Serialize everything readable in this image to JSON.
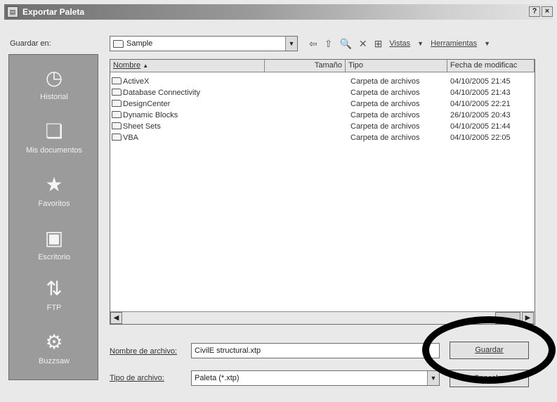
{
  "window": {
    "title": "Exportar Paleta",
    "help": "?",
    "close": "×"
  },
  "location": {
    "label": "Guardar en:",
    "value": "Sample",
    "arrow": "▼"
  },
  "toolbar": {
    "back": "⇦",
    "up": "⇧",
    "search": "🔍",
    "delete": "✕",
    "new_folder": "⊞",
    "views": "Vistas",
    "tools": "Herramientas"
  },
  "places": [
    {
      "label": "Historial",
      "icon": "clock-icon",
      "glyph": "◷"
    },
    {
      "label": "Mis documentos",
      "icon": "documents-icon",
      "glyph": "❏"
    },
    {
      "label": "Favoritos",
      "icon": "star-icon",
      "glyph": "★"
    },
    {
      "label": "Escritorio",
      "icon": "desktop-icon",
      "glyph": "▣"
    },
    {
      "label": "FTP",
      "icon": "ftp-icon",
      "glyph": "⇅"
    },
    {
      "label": "Buzzsaw",
      "icon": "buzzsaw-icon",
      "glyph": "⚙"
    }
  ],
  "columns": [
    "Nombre",
    "Tamaño",
    "Tipo",
    "Fecha de modificac"
  ],
  "files": [
    {
      "name": "ActiveX",
      "size": "",
      "type": "Carpeta de archivos",
      "date": "04/10/2005 21:45"
    },
    {
      "name": "Database Connectivity",
      "size": "",
      "type": "Carpeta de archivos",
      "date": "04/10/2005 21:43"
    },
    {
      "name": "DesignCenter",
      "size": "",
      "type": "Carpeta de archivos",
      "date": "04/10/2005 22:21"
    },
    {
      "name": "Dynamic Blocks",
      "size": "",
      "type": "Carpeta de archivos",
      "date": "26/10/2005 20:43"
    },
    {
      "name": "Sheet Sets",
      "size": "",
      "type": "Carpeta de archivos",
      "date": "04/10/2005 21:44"
    },
    {
      "name": "VBA",
      "size": "",
      "type": "Carpeta de archivos",
      "date": "04/10/2005 22:05"
    }
  ],
  "filename": {
    "label": "Nombre de archivo:",
    "value": "CivilE structural.xtp"
  },
  "filetype": {
    "label": "Tipo de archivo:",
    "value": "Paleta (*.xtp)"
  },
  "buttons": {
    "save": "Guardar",
    "cancel": "Cancelar"
  }
}
